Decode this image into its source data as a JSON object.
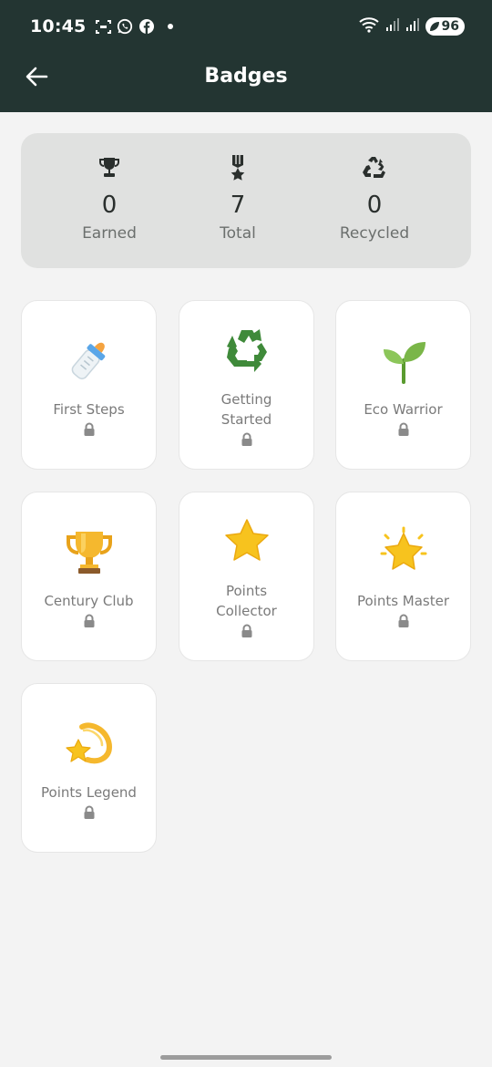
{
  "status_bar": {
    "time": "10:45",
    "battery": "96"
  },
  "header": {
    "title": "Badges"
  },
  "stats": [
    {
      "icon": "trophy-icon",
      "value": "0",
      "label": "Earned"
    },
    {
      "icon": "medal-icon",
      "value": "7",
      "label": "Total"
    },
    {
      "icon": "recycle-icon",
      "value": "0",
      "label": "Recycled"
    }
  ],
  "badges": [
    {
      "icon": "baby-bottle-icon",
      "name": "First Steps",
      "locked": true
    },
    {
      "icon": "recycle-symbol-icon",
      "name": "Getting Started",
      "locked": true
    },
    {
      "icon": "seedling-icon",
      "name": "Eco Warrior",
      "locked": true
    },
    {
      "icon": "trophy-icon",
      "name": "Century Club",
      "locked": true
    },
    {
      "icon": "star-icon",
      "name": "Points Collector",
      "locked": true
    },
    {
      "icon": "glowing-star-icon",
      "name": "Points Master",
      "locked": true
    },
    {
      "icon": "dizzy-icon",
      "name": "Points Legend",
      "locked": true
    }
  ],
  "colors": {
    "header_bg": "#233532",
    "page_bg": "#f3f3f3",
    "stats_bg": "#e0e1e0"
  }
}
